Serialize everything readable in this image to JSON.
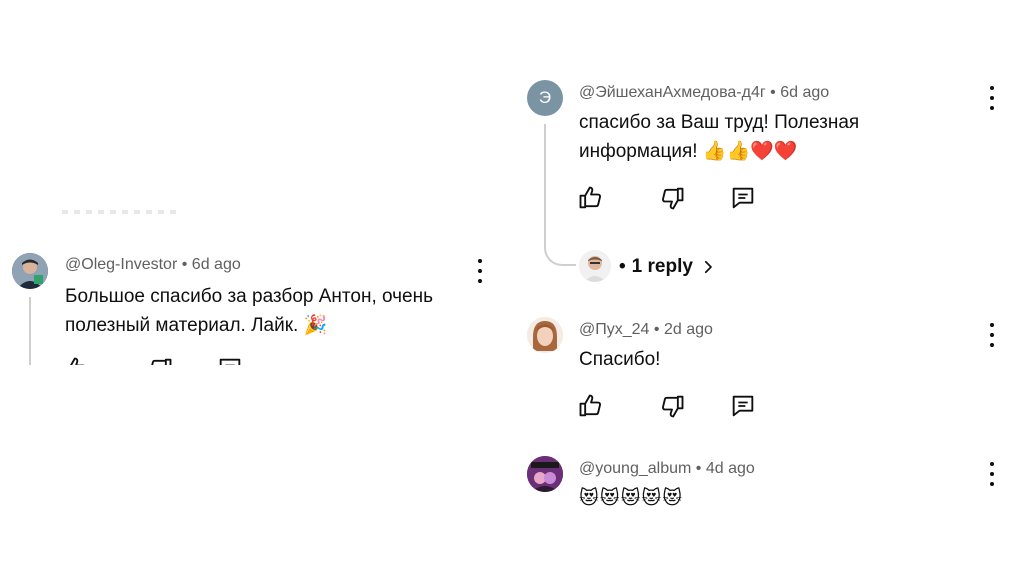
{
  "left_comment": {
    "author": "@Oleg-Investor",
    "time": "6d ago",
    "text": "Большое спасибо за разбор Антон, очень полезный материал. Лайк. 🎉"
  },
  "right_comments": [
    {
      "author": "@ЭйшеханАхмедова-д4г",
      "time": "6d ago",
      "avatar_letter": "Э",
      "avatar_color": "#7a94a4",
      "text_line1": "спасибо за Ваш труд! Полезная",
      "text_line2": "информация! 👍👍❤️❤️",
      "replies_label": "1 reply"
    },
    {
      "author": "@Пух_24",
      "time": "2d ago",
      "text": "Спасибо!"
    },
    {
      "author": "@young_album",
      "time": "4d ago",
      "text": "😻😻😻😻😻"
    }
  ],
  "separator": "•",
  "icons": {
    "like": "thumbs-up-icon",
    "dislike": "thumbs-down-icon",
    "reply": "comment-reply-icon",
    "more": "more-vertical-icon",
    "chevron": "chevron-right-icon"
  }
}
